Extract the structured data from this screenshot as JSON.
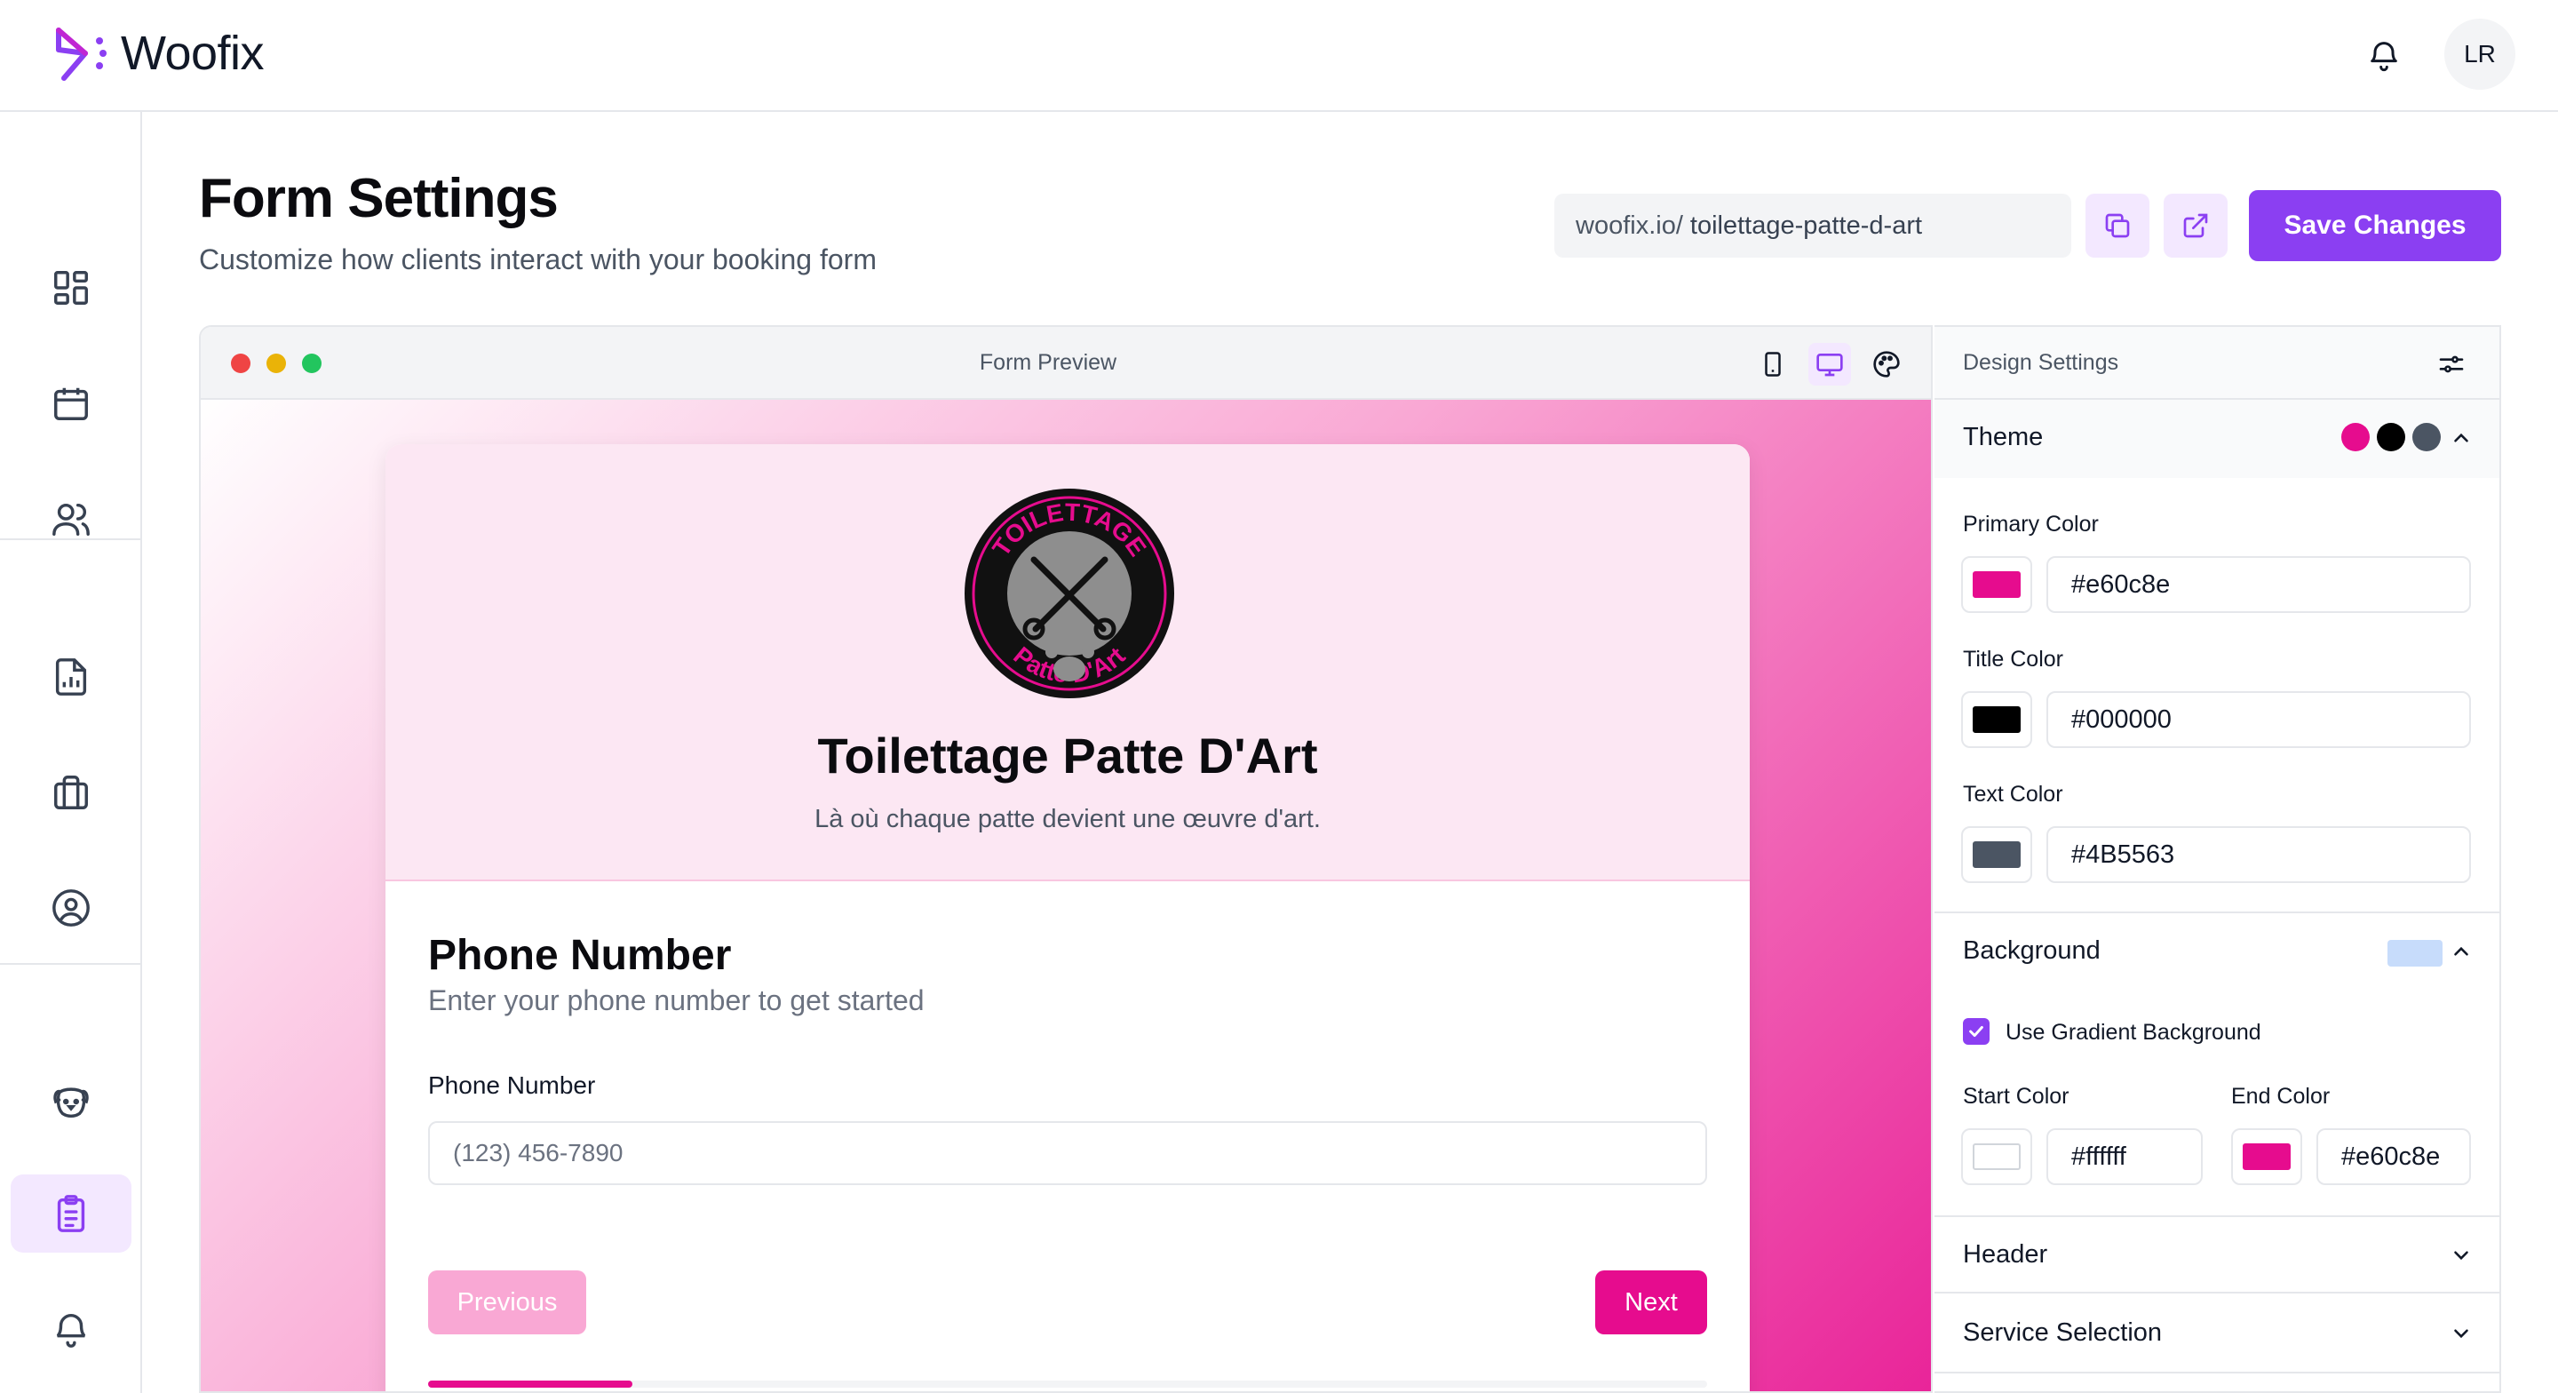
{
  "app": {
    "name": "Woofix",
    "user_initials": "LR"
  },
  "page": {
    "title": "Form Settings",
    "subtitle": "Customize how clients interact with your booking form",
    "url_prefix": "woofix.io/",
    "url_slug": "toilettage-patte-d-art",
    "save_label": "Save Changes"
  },
  "sidebar": {
    "items": [
      {
        "icon": "dashboard-icon"
      },
      {
        "icon": "calendar-icon"
      },
      {
        "icon": "users-icon"
      },
      {
        "icon": "report-icon"
      },
      {
        "icon": "briefcase-icon"
      },
      {
        "icon": "user-circle-icon"
      },
      {
        "icon": "pet-icon"
      },
      {
        "icon": "clipboard-icon",
        "active": true
      },
      {
        "icon": "bell-icon"
      }
    ]
  },
  "preview": {
    "label": "Form Preview",
    "business_name": "Toilettage Patte D'Art",
    "tagline": "Là où chaque patte devient une œuvre d'art.",
    "logo_text_top": "TOILETTAGE",
    "logo_text_bottom": "Patte D'Art",
    "step_title": "Phone Number",
    "step_subtitle": "Enter your phone number to get started",
    "field_label": "Phone Number",
    "field_placeholder": "(123) 456-7890",
    "prev_label": "Previous",
    "next_label": "Next",
    "progress": 0.16
  },
  "design": {
    "title": "Design Settings",
    "theme": {
      "label": "Theme",
      "primary_label": "Primary Color",
      "primary_value": "#e60c8e",
      "title_label": "Title Color",
      "title_value": "#000000",
      "text_label": "Text Color",
      "text_value": "#4B5563"
    },
    "background": {
      "label": "Background",
      "gradient_label": "Use Gradient Background",
      "gradient_enabled": true,
      "start_label": "Start Color",
      "start_value": "#ffffff",
      "end_label": "End Color",
      "end_value": "#e60c8e"
    },
    "header_label": "Header",
    "service_label": "Service Selection"
  },
  "colors": {
    "accent": "#8b3ff2",
    "brand_pink": "#e60c8e",
    "pink_light": "#fce7f3"
  }
}
